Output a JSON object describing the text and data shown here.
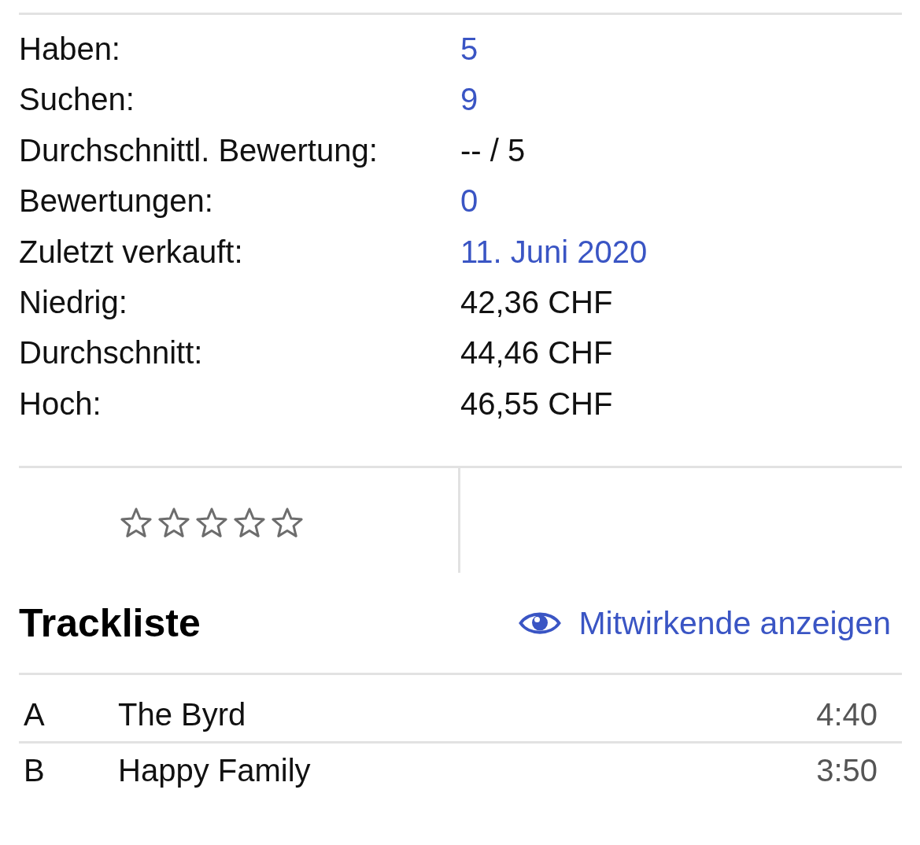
{
  "stats": [
    {
      "label": "Haben:",
      "value": "5",
      "kind": "link"
    },
    {
      "label": "Suchen:",
      "value": "9",
      "kind": "link"
    },
    {
      "label": "Durchschnittl. Bewertung:",
      "value": "-- / 5",
      "kind": "text"
    },
    {
      "label": "Bewertungen:",
      "value": "0",
      "kind": "link"
    },
    {
      "label": "Zuletzt verkauft:",
      "value": "11. Juni 2020",
      "kind": "link"
    },
    {
      "label": "Niedrig:",
      "value": "42,36 CHF",
      "kind": "text"
    },
    {
      "label": "Durchschnitt:",
      "value": "44,46 CHF",
      "kind": "text"
    },
    {
      "label": "Hoch:",
      "value": "46,55 CHF",
      "kind": "text"
    }
  ],
  "rating": {
    "stars": 0
  },
  "tracklist": {
    "title": "Trackliste",
    "credits_link": "Mitwirkende anzeigen",
    "tracks": [
      {
        "position": "A",
        "title": "The Byrd",
        "duration": "4:40"
      },
      {
        "position": "B",
        "title": "Happy Family",
        "duration": "3:50"
      }
    ]
  }
}
